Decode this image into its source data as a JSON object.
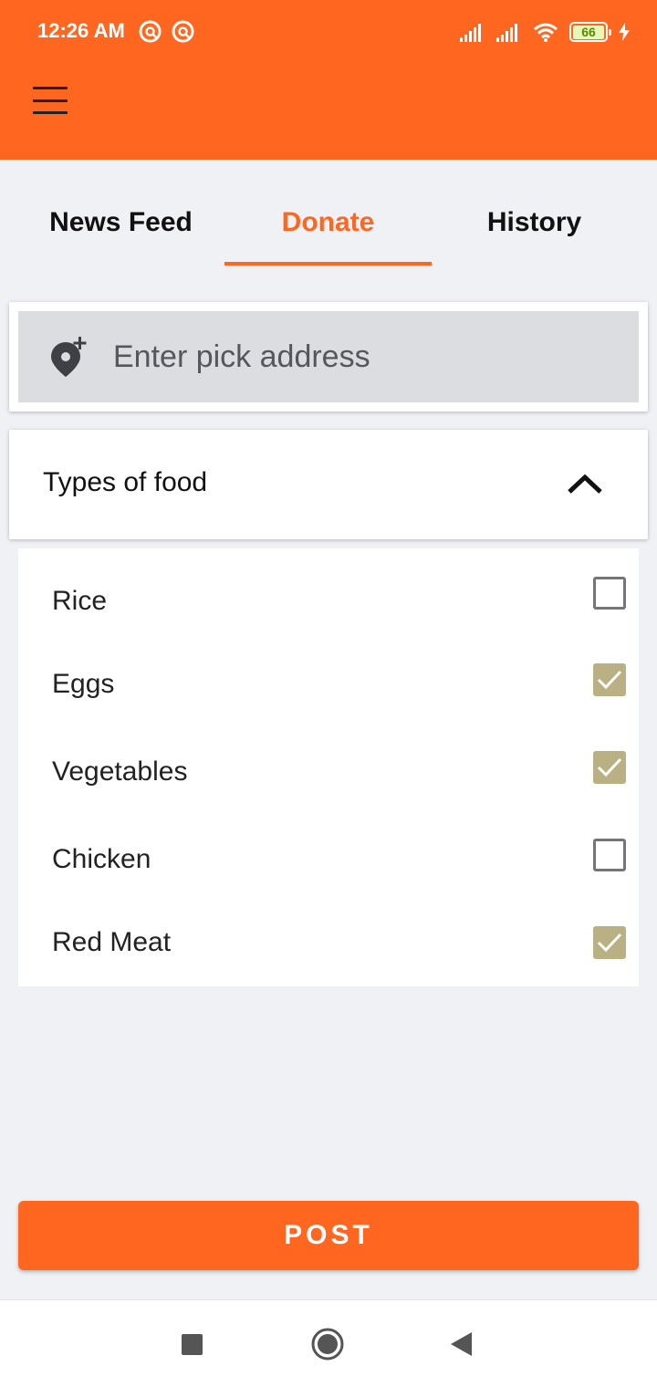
{
  "status_bar": {
    "time": "12:26 AM",
    "battery": "66"
  },
  "tabs": [
    {
      "label": "News Feed",
      "active": false
    },
    {
      "label": "Donate",
      "active": true
    },
    {
      "label": "History",
      "active": false
    }
  ],
  "address": {
    "placeholder": "Enter pick address"
  },
  "food_section": {
    "title": "Types of food",
    "items": [
      {
        "label": "Rice",
        "checked": false
      },
      {
        "label": "Eggs",
        "checked": true
      },
      {
        "label": "Vegetables",
        "checked": true
      },
      {
        "label": "Chicken",
        "checked": false
      },
      {
        "label": "Red Meat",
        "checked": true
      }
    ]
  },
  "post_button": {
    "label": "POST"
  },
  "colors": {
    "accent": "#FF6721",
    "background": "#F0F1F5",
    "checkbox_checked": "#B9B083"
  }
}
